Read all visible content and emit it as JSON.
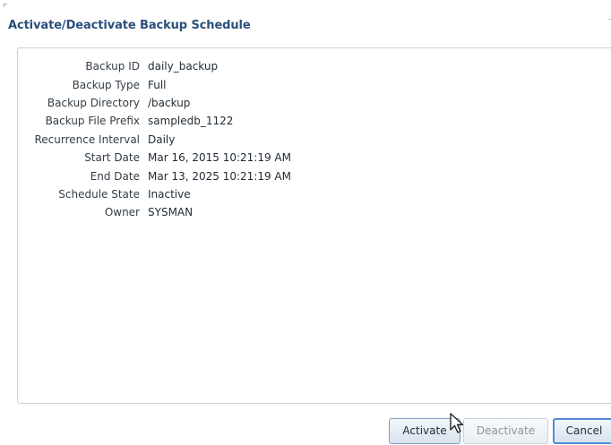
{
  "dialog": {
    "title": "Activate/Deactivate Backup Schedule",
    "close_glyph": "˙",
    "close_icon": "close-icon"
  },
  "details": [
    {
      "label": "Backup ID",
      "value": "daily_backup"
    },
    {
      "label": "Backup Type",
      "value": "Full"
    },
    {
      "label": "Backup Directory",
      "value": "/backup"
    },
    {
      "label": "Backup File Prefix",
      "value": "sampledb_1122"
    },
    {
      "label": "Recurrence Interval",
      "value": "Daily"
    },
    {
      "label": "Start Date",
      "value": "Mar 16, 2015 10:21:19 AM"
    },
    {
      "label": "End Date",
      "value": "Mar 13, 2025 10:21:19 AM"
    },
    {
      "label": "Schedule State",
      "value": "Inactive"
    },
    {
      "label": "Owner",
      "value": "SYSMAN"
    }
  ],
  "buttons": {
    "activate": "Activate",
    "deactivate": "Deactivate",
    "cancel": "Cancel"
  },
  "colors": {
    "title": "#2a4f7a",
    "focus_border": "#4f8fd0",
    "disabled_text": "#8a949e"
  },
  "cursor_icon": "mouse-pointer-icon"
}
